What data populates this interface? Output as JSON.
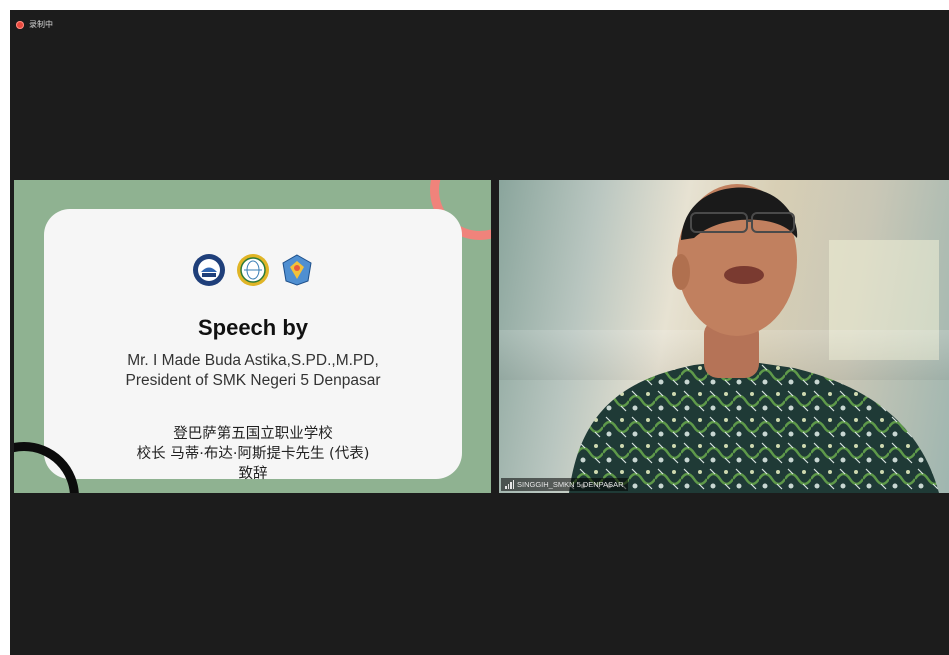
{
  "recording": {
    "label": "录制中",
    "indicator_color": "#e8493d"
  },
  "slide": {
    "title": "Speech by",
    "line1": "Mr. I Made Buda Astika,S.PD.,M.PD,",
    "line2": "President of SMK Negeri 5 Denpasar",
    "cn_line1": "登巴萨第五国立职业学校",
    "cn_line2": "校长 马蒂·布达·阿斯提卡先生 (代表)",
    "cn_line3": "致辞",
    "logos": [
      "university-seal-logo",
      "center-emblem-logo",
      "school-crest-logo"
    ],
    "background_color": "#8fb291",
    "accent_colors": [
      "#f0837b",
      "#0c0c0c"
    ]
  },
  "video": {
    "participant_name": "SINGGIH_SMKN 5 DENPASAR",
    "signal_icon": "signal-bars-icon"
  }
}
